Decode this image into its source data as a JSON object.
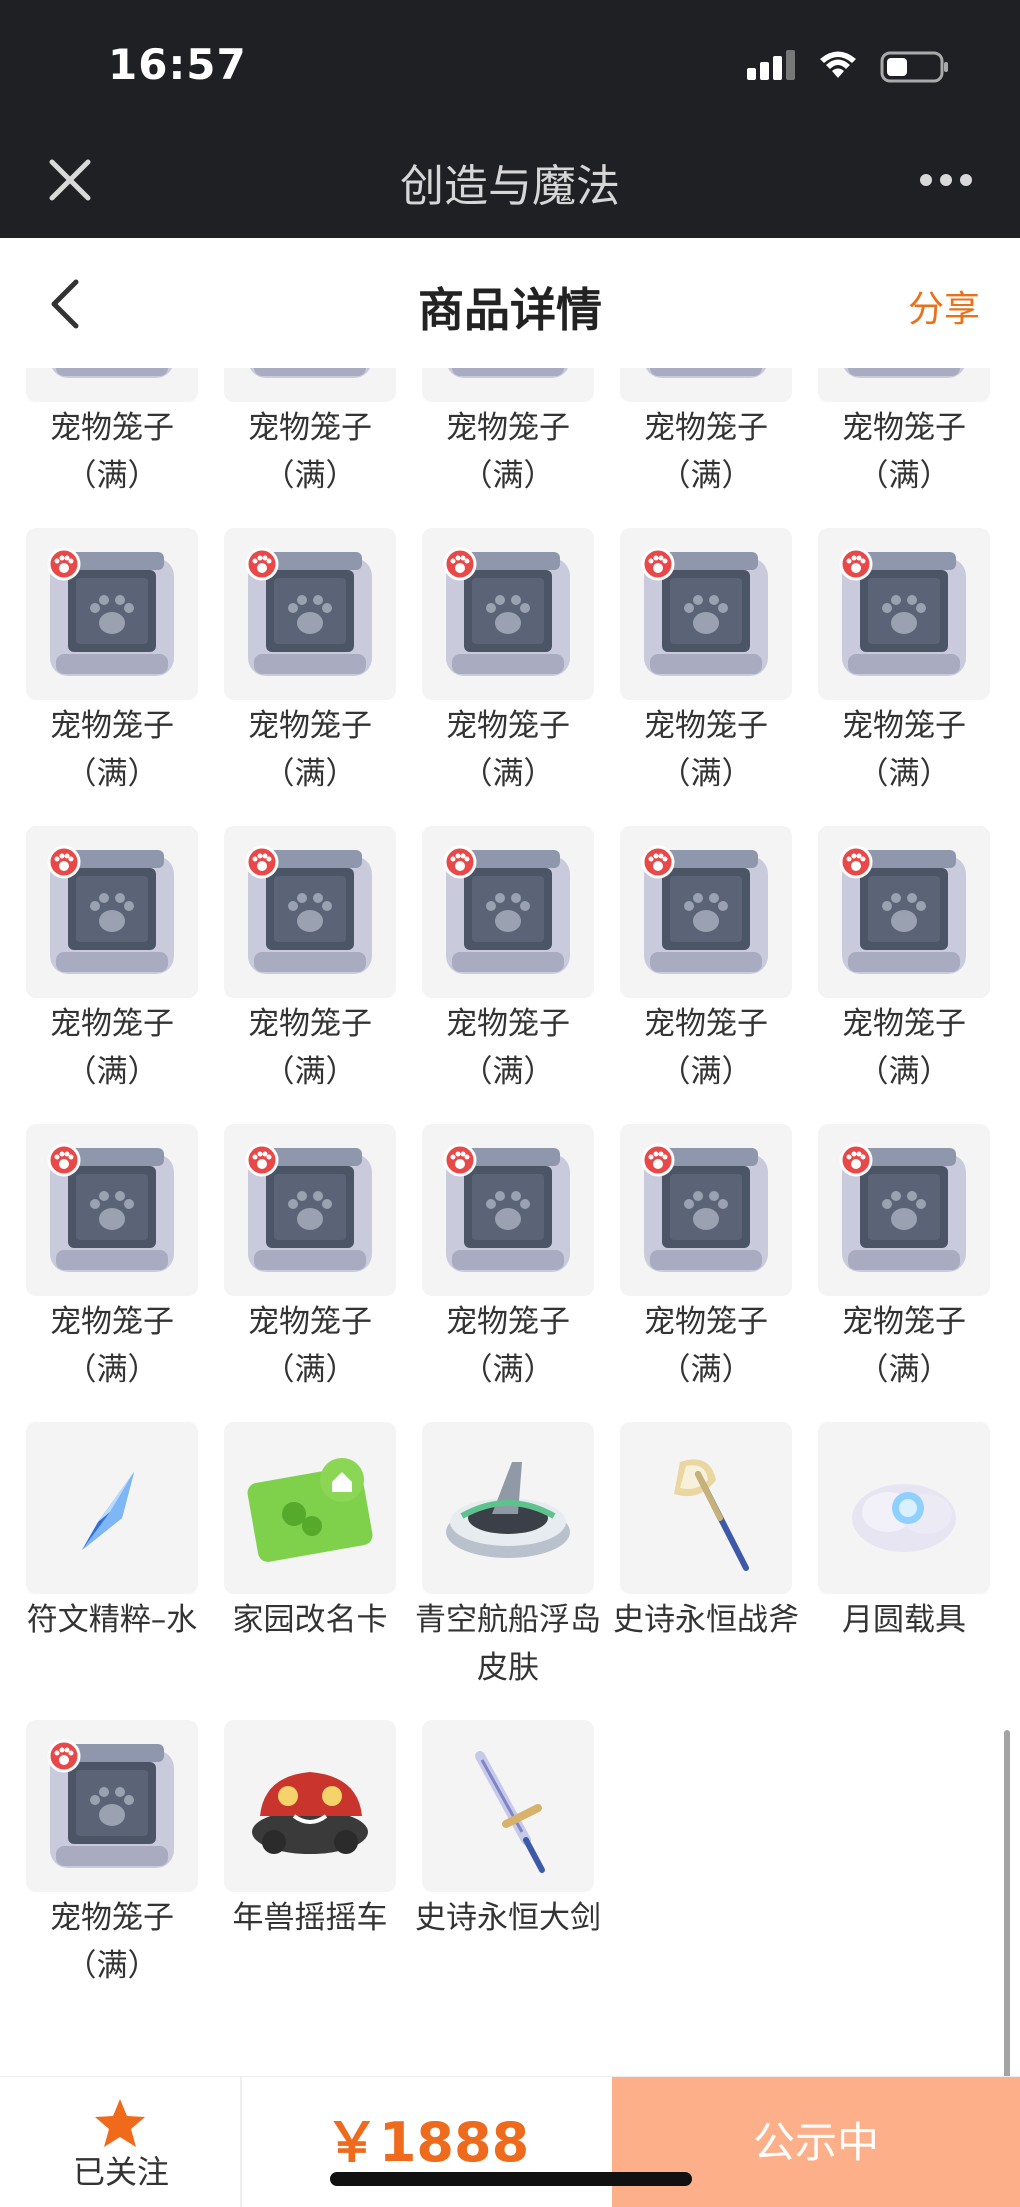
{
  "status_bar": {
    "time": "16:57"
  },
  "wechat_bar": {
    "title": "创造与魔法",
    "close_icon": "close-icon",
    "more_icon": "more-icon"
  },
  "nav": {
    "title": "商品详情",
    "share": "分享",
    "back_icon": "back-icon"
  },
  "items": [
    {
      "label": "宠物笼子（满）",
      "icon": "pet-cage"
    },
    {
      "label": "宠物笼子（满）",
      "icon": "pet-cage"
    },
    {
      "label": "宠物笼子（满）",
      "icon": "pet-cage"
    },
    {
      "label": "宠物笼子（满）",
      "icon": "pet-cage"
    },
    {
      "label": "宠物笼子（满）",
      "icon": "pet-cage"
    },
    {
      "label": "宠物笼子（满）",
      "icon": "pet-cage"
    },
    {
      "label": "宠物笼子（满）",
      "icon": "pet-cage"
    },
    {
      "label": "宠物笼子（满）",
      "icon": "pet-cage"
    },
    {
      "label": "宠物笼子（满）",
      "icon": "pet-cage"
    },
    {
      "label": "宠物笼子（满）",
      "icon": "pet-cage"
    },
    {
      "label": "宠物笼子（满）",
      "icon": "pet-cage"
    },
    {
      "label": "宠物笼子（满）",
      "icon": "pet-cage"
    },
    {
      "label": "宠物笼子（满）",
      "icon": "pet-cage"
    },
    {
      "label": "宠物笼子（满）",
      "icon": "pet-cage"
    },
    {
      "label": "宠物笼子（满）",
      "icon": "pet-cage"
    },
    {
      "label": "宠物笼子（满）",
      "icon": "pet-cage"
    },
    {
      "label": "宠物笼子（满）",
      "icon": "pet-cage"
    },
    {
      "label": "宠物笼子（满）",
      "icon": "pet-cage"
    },
    {
      "label": "宠物笼子（满）",
      "icon": "pet-cage"
    },
    {
      "label": "宠物笼子（满）",
      "icon": "pet-cage"
    },
    {
      "label": "符文精粹–水",
      "icon": "rune-crystal"
    },
    {
      "label": "家园改名卡",
      "icon": "rename-card"
    },
    {
      "label": "青空航船浮岛皮肤",
      "icon": "floating-island"
    },
    {
      "label": "史诗永恒战斧",
      "icon": "battle-axe"
    },
    {
      "label": "月圆载具",
      "icon": "moon-mount"
    },
    {
      "label": "宠物笼子（满）",
      "icon": "pet-cage"
    },
    {
      "label": "年兽摇摇车",
      "icon": "nian-car"
    },
    {
      "label": "史诗永恒大剑",
      "icon": "greatsword"
    }
  ],
  "bottom_bar": {
    "follow_label": "已关注",
    "price": "￥1888",
    "status_button": "公示中"
  },
  "colors": {
    "accent": "#ee6a1c",
    "status_button_bg": "#fcaf88",
    "topbar_bg": "#1e2023"
  }
}
